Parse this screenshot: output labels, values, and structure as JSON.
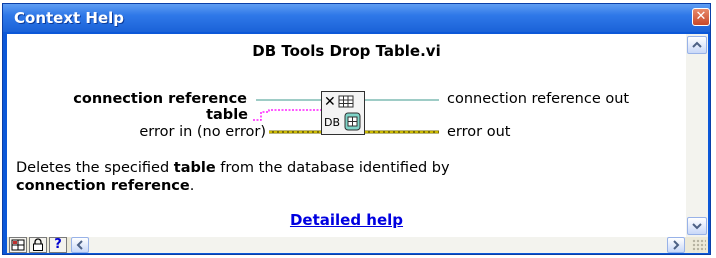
{
  "window": {
    "title": "Context Help",
    "close_glyph": "✕"
  },
  "vi": {
    "name": "DB Tools Drop Table.vi",
    "icon_label": "DB"
  },
  "terminals": {
    "inputs": [
      {
        "label": "connection reference",
        "bold": true
      },
      {
        "label": "table",
        "bold": true
      },
      {
        "label": "error in (no error)",
        "bold": false
      }
    ],
    "outputs": [
      {
        "label": "connection reference out"
      },
      {
        "label": "error out"
      }
    ]
  },
  "description": {
    "part1": "Deletes the specified ",
    "part2": "table",
    "part3": " from the database identified by ",
    "part4": "connection reference",
    "part5": "."
  },
  "link": {
    "label": "Detailed help"
  },
  "toolbar": {
    "buttons": [
      {
        "name": "show-optional-terminals-button",
        "icon": "terminal-pattern-icon"
      },
      {
        "name": "lock-button",
        "icon": "lock-icon"
      },
      {
        "name": "help-button",
        "icon": "question-icon",
        "glyph": "?"
      }
    ]
  },
  "colors": {
    "title_bar": "#2f78e8",
    "wire_reference": "#3c9a8c",
    "wire_table": "#ff20ff",
    "wire_error": "#c8b400",
    "link": "#0000e0"
  }
}
